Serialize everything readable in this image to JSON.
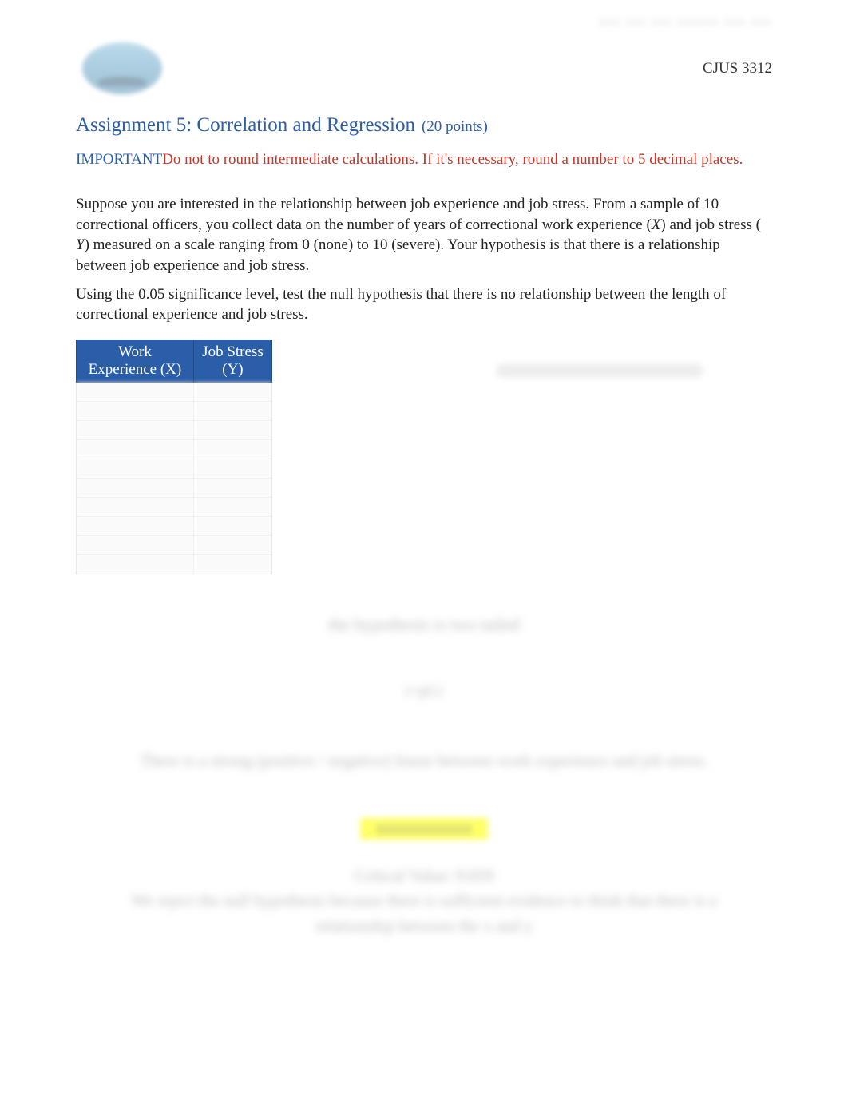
{
  "header": {
    "blurred_top": "xxx xxx xxx xxxxxx xxx xxx",
    "course_code": "CJUS 3312"
  },
  "title": {
    "main": "Assignment 5:  Correlation and Regression",
    "points": "(20 points)"
  },
  "important": {
    "label": "IMPORTANT",
    "text": "Do not to round intermediate calculations. If it's necessary, round a number to 5 decimal places."
  },
  "body": {
    "p1_a": "Suppose you are interested in the relationship between job experience and job stress. From a sample of 10 correctional officers, you collect data on the number of years of correctional work experience (",
    "p1_x": "X",
    "p1_b": ") and job stress ( ",
    "p1_y": "Y",
    "p1_c": ") measured on a scale ranging from 0 (none) to 10 (severe). Your hypothesis is that there is a relationship between job experience and job stress.",
    "p2": "Using the 0.05 significance level, test the null hypothesis that there is no relationship between the length of correctional experience and job stress."
  },
  "table": {
    "headers": {
      "x": "Work Experience (X)",
      "y": "Job Stress (Y)"
    }
  },
  "blurred": {
    "b1": "the hypothesis is two tailed",
    "b2": "r=pCr",
    "b3": "There is a strong (positive / negative) linear between work experience and job stress.",
    "b_highlight": "xxxxxxxxxxxx",
    "b4a": "Critical Value: 9.059",
    "b4b": "We reject the null hypothesis because there is sufficient evidence to think that there is a relationship between the x and y"
  }
}
